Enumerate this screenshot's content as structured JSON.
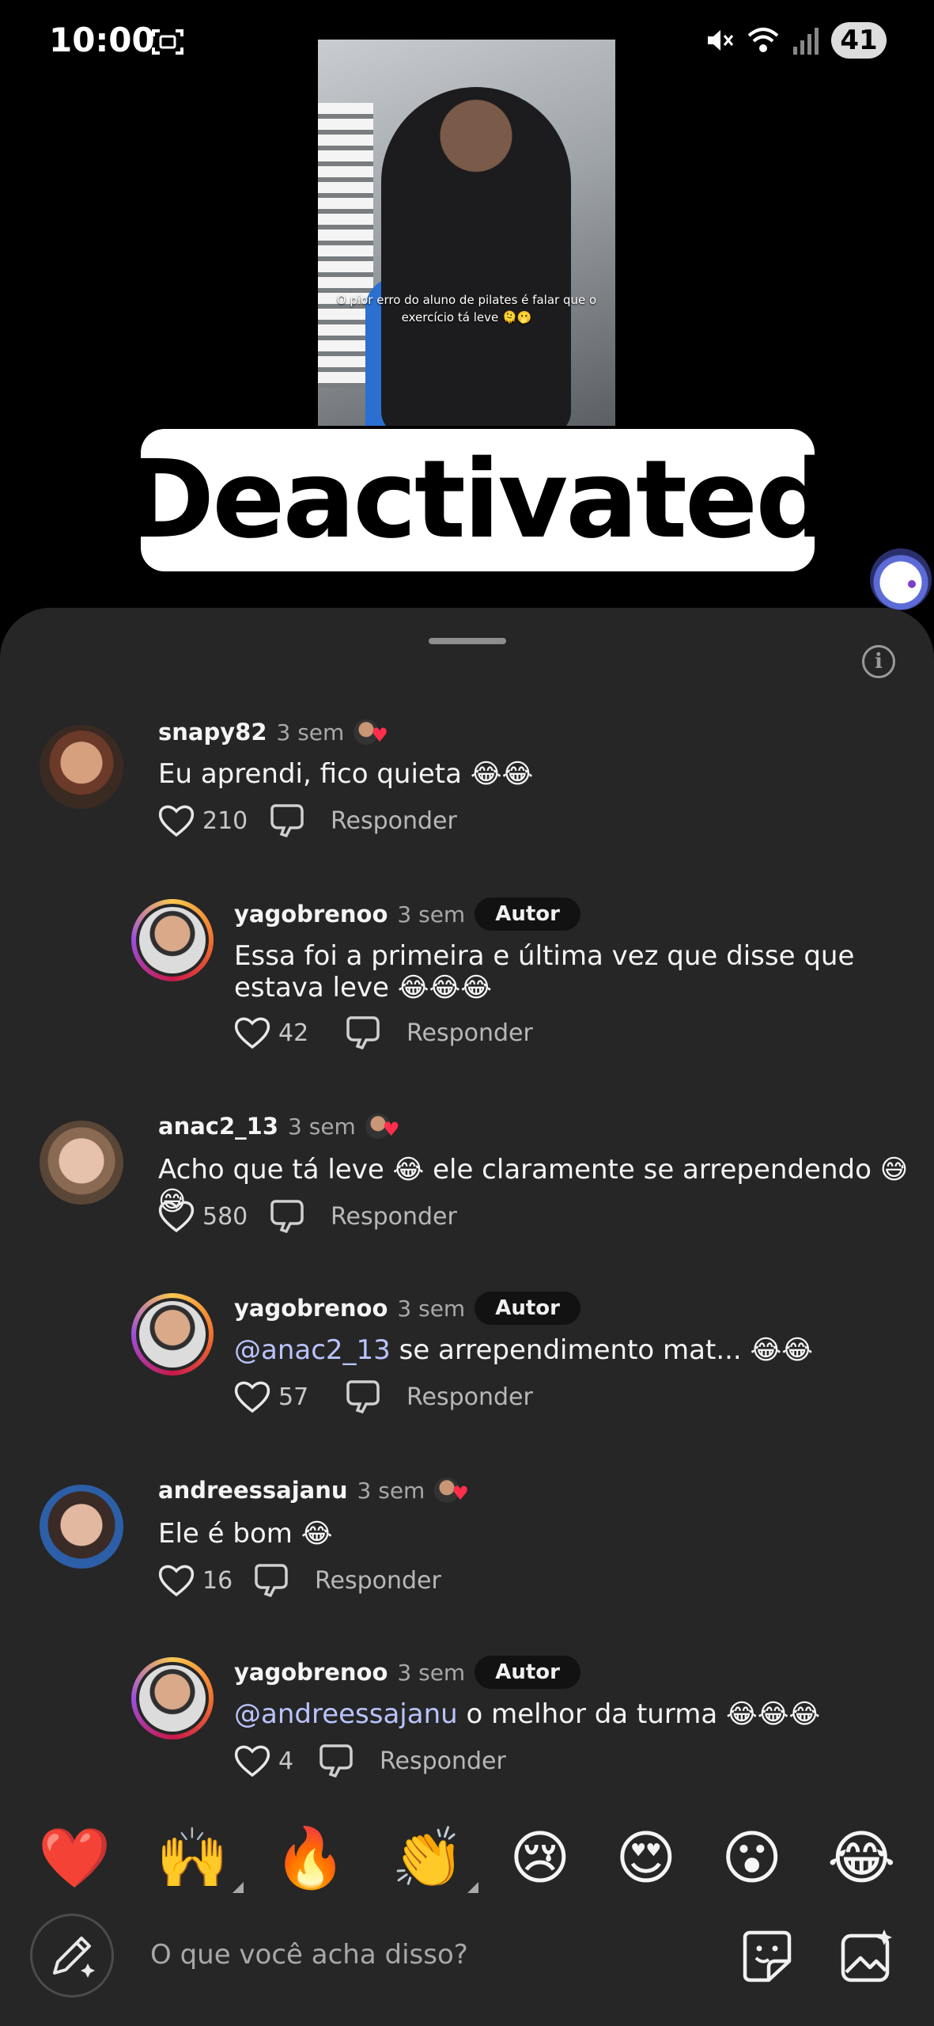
{
  "status_bar": {
    "time": "10:00",
    "battery": "41"
  },
  "video": {
    "caption": "O pior erro do aluno de pilates é falar que o exercício tá leve 🫠🫢"
  },
  "overlay": {
    "label": "Deactivated"
  },
  "comments": [
    {
      "user": "snapy82",
      "ago": "3 sem",
      "text": "Eu aprendi, fico quieta 😂😂",
      "likes": "210",
      "reply": "Responder"
    },
    {
      "user": "yagobrenoo",
      "ago": "3 sem",
      "badge": "Autor",
      "text": "Essa foi a primeira e última vez que disse que estava leve 😂😂😂",
      "likes": "42",
      "reply": "Responder"
    },
    {
      "user": "anac2_13",
      "ago": "3 sem",
      "text": "Acho que tá leve 😂 ele claramente se arrependendo 😅😅",
      "likes": "580",
      "reply": "Responder"
    },
    {
      "user": "yagobrenoo",
      "ago": "3 sem",
      "badge": "Autor",
      "mention": "@anac2_13",
      "text": " se arrependimento mat... 😂😂",
      "likes": "57",
      "reply": "Responder"
    },
    {
      "user": "andreessajanu",
      "ago": "3 sem",
      "text": "Ele é bom 😂",
      "likes": "16",
      "reply": "Responder"
    },
    {
      "user": "yagobrenoo",
      "ago": "3 sem",
      "badge": "Autor",
      "mention": "@andreessajanu",
      "text": " o melhor da turma 😂😂😂",
      "likes": "4",
      "reply": "Responder"
    }
  ],
  "emoji_bar": [
    "❤️",
    "🙌",
    "🔥",
    "👏",
    "😢",
    "😍",
    "😮",
    "😂"
  ],
  "composer": {
    "placeholder": "O que você acha disso?"
  },
  "colors": {
    "sheet_bg": "#262626",
    "text": "#f5f5f5",
    "muted": "#a8a8a8",
    "mention": "#b9c4ff"
  }
}
